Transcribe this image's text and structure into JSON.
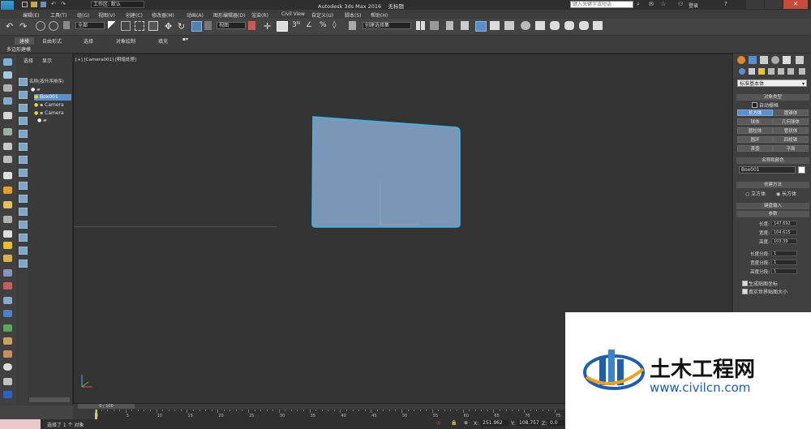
{
  "window": {
    "workspace_label": "工作区: 默认",
    "title": "Autodesk 3ds Max 2016",
    "file_name": "无标题",
    "search_placeholder": "键入关键字或短语",
    "login": "登录"
  },
  "menu": [
    "编辑(E)",
    "工具(T)",
    "组(G)",
    "视图(V)",
    "创建(C)",
    "修改器(M)",
    "动画(A)",
    "图形编辑器(D)",
    "渲染(R)",
    "Civil View",
    "自定义(U)",
    "脚本(S)",
    "帮助(H)"
  ],
  "toolbar": {
    "selection_filter": "全部",
    "reference_coord": "视图",
    "named_selection": "创建选择集"
  },
  "ribbon": {
    "tabs": [
      "建模",
      "自由形式",
      "选择",
      "对象绘制",
      "填充"
    ],
    "sub_label": "多边形建模"
  },
  "scene_explorer": {
    "tabs": [
      "选择",
      "显示"
    ],
    "header": "名称(按升序排序)",
    "items": [
      "Box001",
      "Camera",
      "Camera"
    ]
  },
  "viewport": {
    "label": "[+] [Camera001] [明暗处理]"
  },
  "command_panel": {
    "category": "标准基本体",
    "object_type_header": "对象类型",
    "autogrid": "自动栅格",
    "object_buttons": [
      "长方体",
      "圆锥体",
      "球体",
      "几何球体",
      "圆柱体",
      "管状体",
      "圆环",
      "四棱锥",
      "茶壶",
      "平面"
    ],
    "name_color_header": "名称和颜色",
    "object_name": "Box001",
    "creation_method_header": "创建方法",
    "creation_options": [
      "立方体",
      "长方体"
    ],
    "keyboard_entry_header": "键盘输入",
    "params_header": "参数",
    "params": [
      {
        "label": "长度:",
        "value": "147.692"
      },
      {
        "label": "宽度:",
        "value": "104.615"
      },
      {
        "label": "高度:",
        "value": "103.39"
      }
    ],
    "segments": [
      {
        "label": "长度分段:",
        "value": "1"
      },
      {
        "label": "宽度分段:",
        "value": "1"
      },
      {
        "label": "高度分段:",
        "value": "1"
      }
    ],
    "gen_mapping": "生成贴图坐标",
    "real_world": "真实世界贴图大小"
  },
  "timeline": {
    "frame_label": "0 / 100",
    "ticks": [
      "0",
      "5",
      "10",
      "15",
      "20",
      "25",
      "30",
      "35",
      "40",
      "45",
      "50",
      "55",
      "60",
      "65",
      "70",
      "75"
    ]
  },
  "status": {
    "message": "选择了 1 个 对象",
    "x_label": "X:",
    "x_value": "251.962",
    "y_label": "Y:",
    "y_value": "108.757",
    "z_label": "Z:",
    "z_value": "0.0"
  },
  "watermark": {
    "title": "土木工程网",
    "url": "www.civilcn.com"
  },
  "colors": {
    "accent": "#5b8fc9",
    "box_fill": "#7a97b8",
    "box_edge": "#3fb4e8",
    "watermark_blue": "#1f5fa8"
  }
}
